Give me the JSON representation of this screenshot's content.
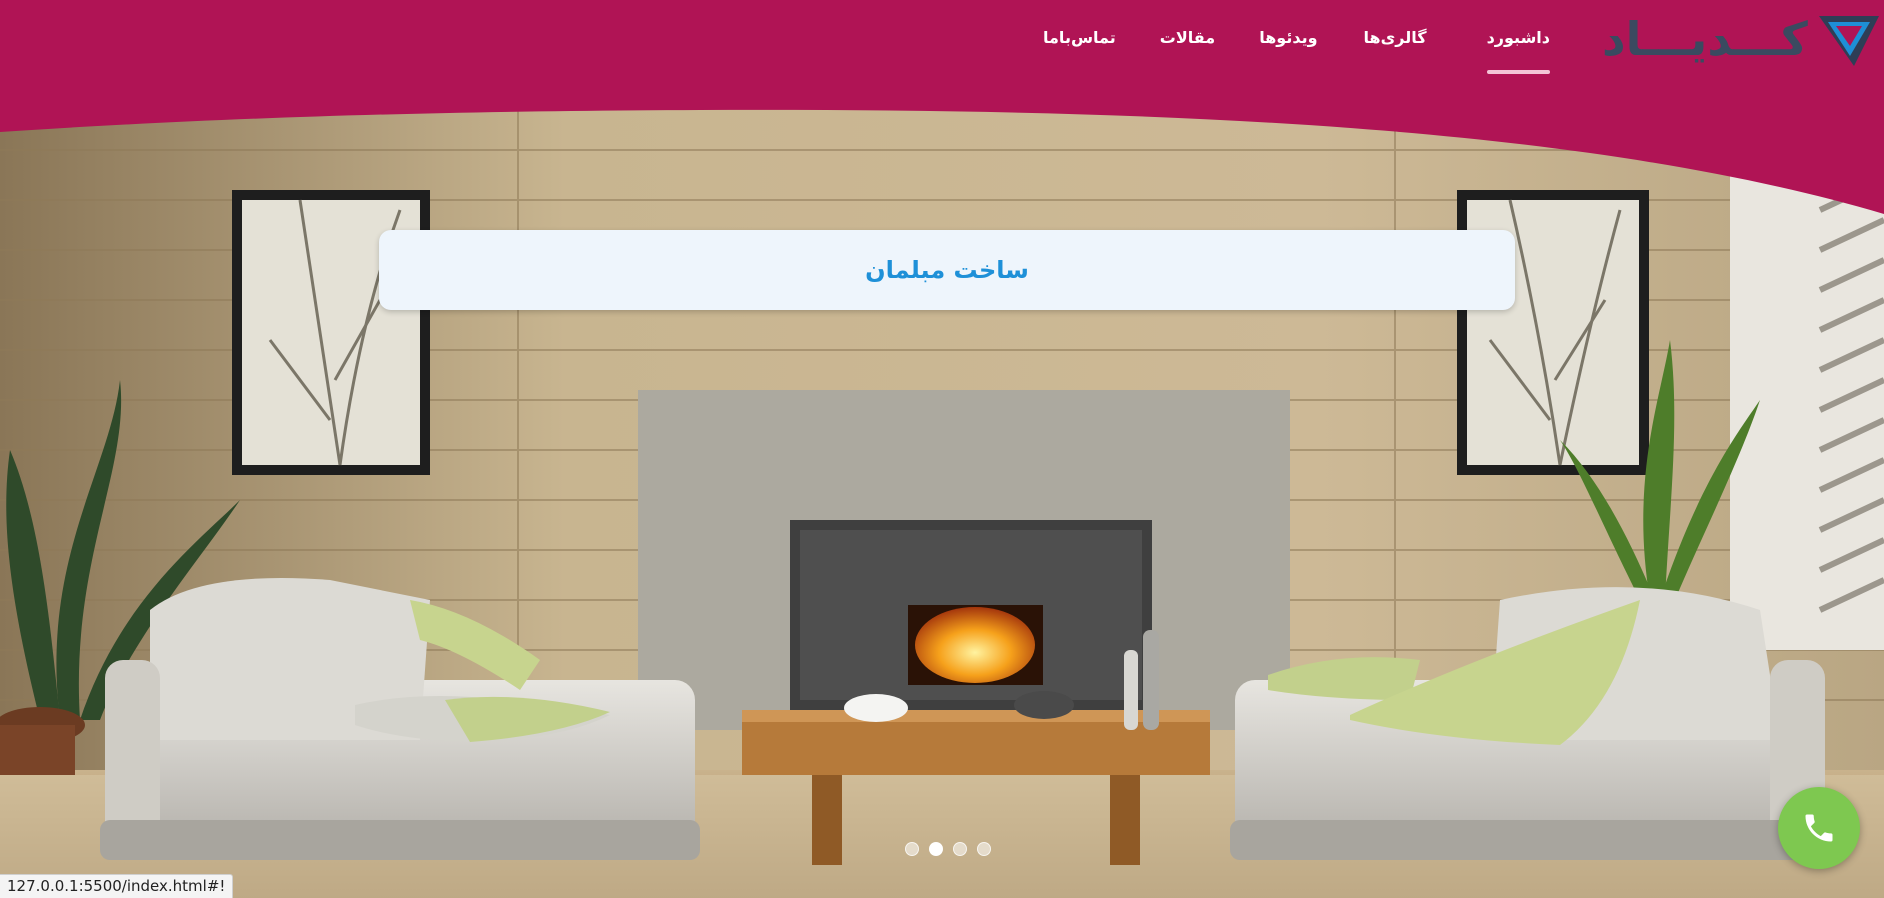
{
  "header": {
    "logo_text": "کـــدیـــاد",
    "nav": [
      {
        "label": "داشبورد",
        "active": true
      },
      {
        "label": "گالری‌ها",
        "active": false
      },
      {
        "label": "ویدئوها",
        "active": false
      },
      {
        "label": "مقالات",
        "active": false
      },
      {
        "label": "تماس‌باما",
        "active": false
      }
    ]
  },
  "hero": {
    "title": "ساخت مبلمان",
    "slides_count": 4,
    "active_slide": 2
  },
  "fab": {
    "icon": "phone-icon"
  },
  "status_bar": {
    "url": "127.0.0.1:5500/index.html#!"
  },
  "colors": {
    "header_bg": "#b01455",
    "title_text": "#1e90d8",
    "title_card_bg": "#eef5fc",
    "fab_bg": "#7ec850",
    "logo_text": "#3a4a60",
    "logo_accent": "#1e8fd6"
  }
}
